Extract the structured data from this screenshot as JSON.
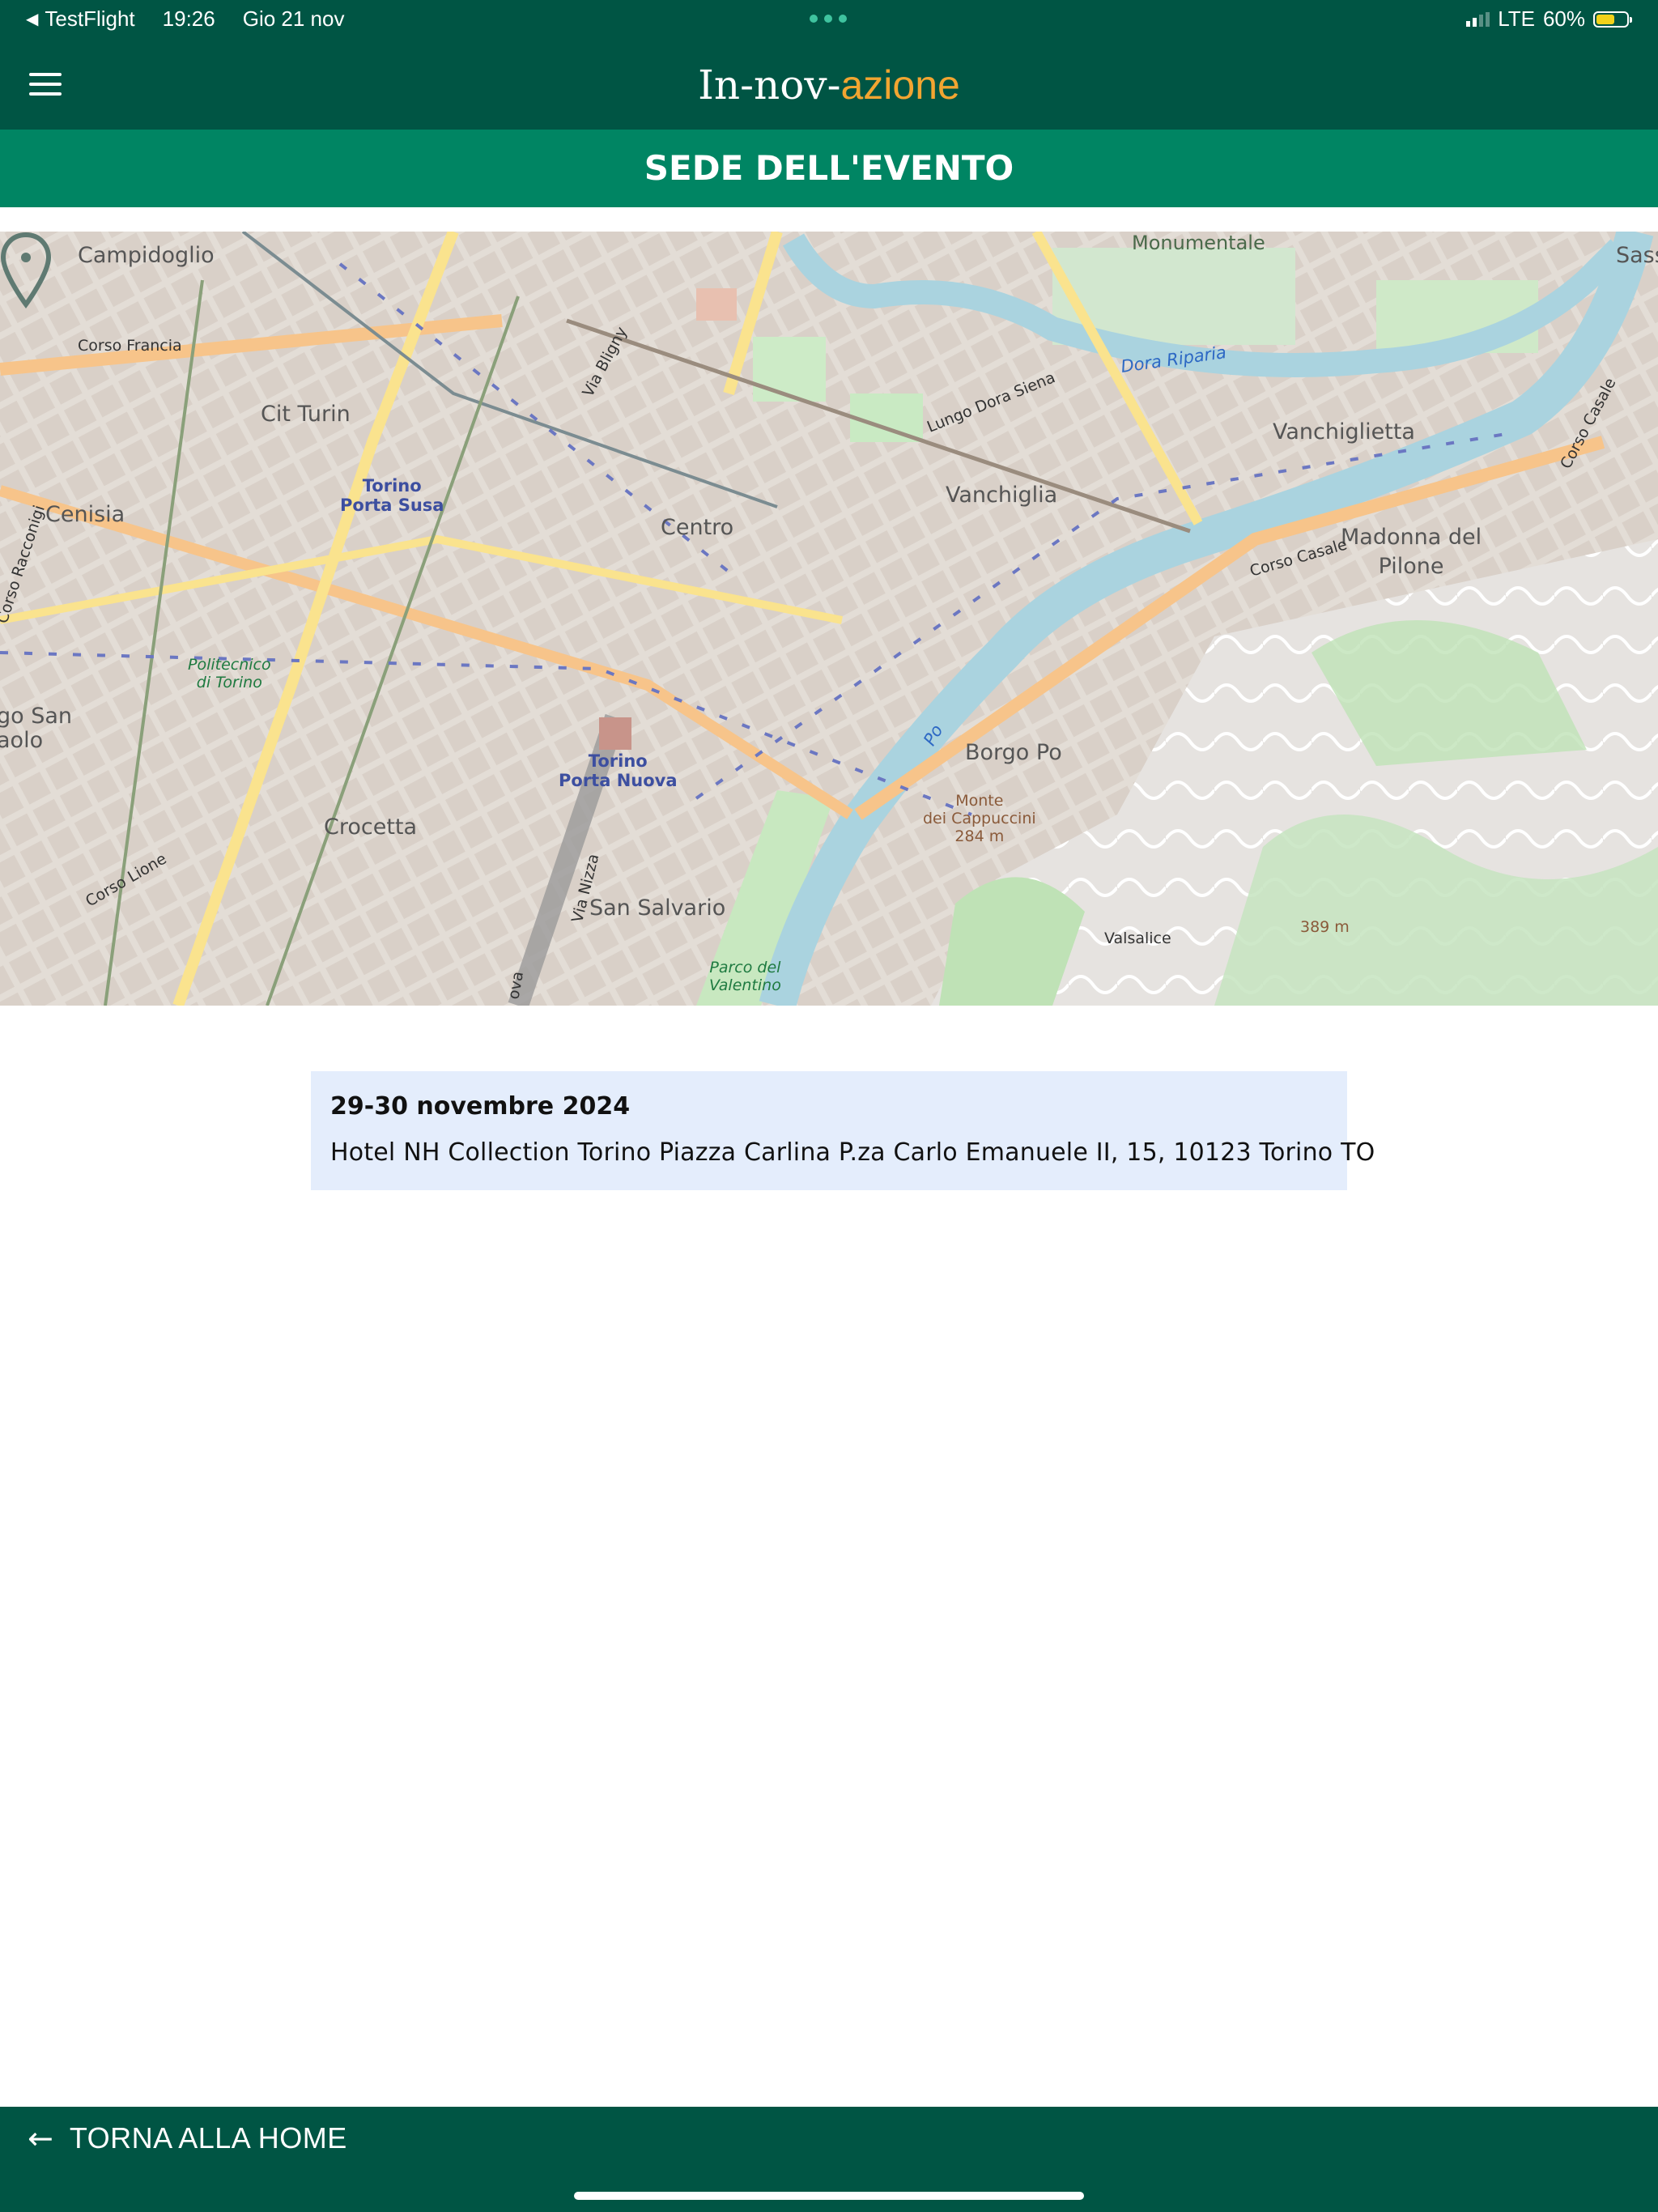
{
  "status_bar": {
    "back_app": "TestFlight",
    "time": "19:26",
    "date": "Gio 21 nov",
    "network": "LTE",
    "battery": "60%",
    "battery_level": 0.6
  },
  "header": {
    "brand_part1": "In-nov-",
    "brand_part2": "azione",
    "brand_accent_color": "#f2a531",
    "menu_icon": "hamburger-menu-icon"
  },
  "section": {
    "title": "SEDE DELL'EVENTO"
  },
  "map": {
    "labels": {
      "campidoglio": "Campidoglio",
      "monumentale": "Monumentale",
      "sassi": "Sass",
      "corso_francia": "Corso Francia",
      "cit_turin": "Cit Turin",
      "torino_porta_susa": "Torino\nPorta Susa",
      "via_bligny": "Via Bligny",
      "dora_riparia": "Dora Riparia",
      "lungo_dora_siena": "Lungo Dora Siena",
      "vanchiglietta": "Vanchiglietta",
      "corso_casale_ne": "Corso Casale",
      "cenisia": "Cenisia",
      "corso_racconigi": "Corso Racconigi",
      "centro": "Centro",
      "vanchiglia": "Vanchiglia",
      "madonna_del_pilone": "Madonna del\nPilone",
      "corso_casale": "Corso Casale",
      "politecnico": "Politecnico\ndi Torino",
      "san_paolo": "go San\naolo",
      "borgo_po": "Borgo Po",
      "po": "Po",
      "monte_cappuccini": "Monte\ndei Cappuccini\n284 m",
      "torino_porta_nuova": "Torino\nPorta Nuova",
      "crocetta": "Crocetta",
      "corso_lione": "Corso Lione",
      "via_nizza": "Via Nizza",
      "san_salvario": "San Salvario",
      "valsalice": "Valsalice",
      "elevation_389": "389 m",
      "parco_valentino": "Parco del\nValentino",
      "nova": "ova"
    },
    "marker_icon": "map-pin-icon"
  },
  "event": {
    "date": "29-30 novembre 2024",
    "address": "Hotel NH Collection Torino Piazza Carlina P.za Carlo Emanuele II, 15, 10123 Torino TO"
  },
  "footer": {
    "back_label": "TORNA ALLA HOME",
    "back_icon": "arrow-left-icon"
  },
  "colors": {
    "dark_green": "#005544",
    "section_green": "#008563",
    "card_bg": "#e4edfc"
  }
}
